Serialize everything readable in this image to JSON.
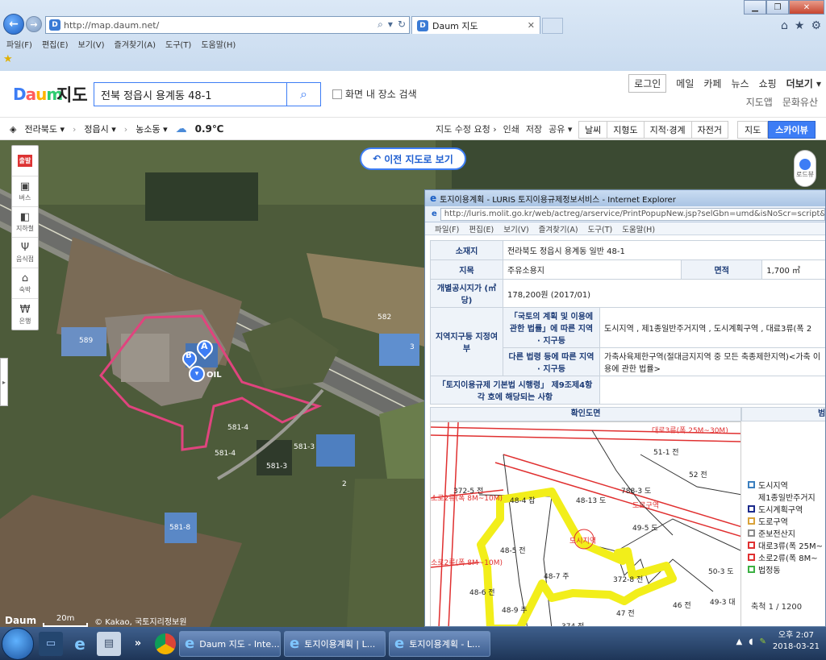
{
  "browser": {
    "url": "http://map.daum.net/",
    "tab_title": "Daum 지도",
    "menu": [
      "파일(F)",
      "편집(E)",
      "보기(V)",
      "즐겨찾기(A)",
      "도구(T)",
      "도움말(H)"
    ]
  },
  "header": {
    "logo": [
      "D",
      "a",
      "u",
      "m"
    ],
    "title": "지도",
    "search_value": "전북 정읍시 용계동 48-1",
    "area_search_label": "화면 내 장소 검색",
    "top_links": [
      "로그인",
      "메일",
      "카페",
      "뉴스",
      "쇼핑",
      "더보기"
    ],
    "sub_links": [
      "지도앱",
      "문화유산"
    ]
  },
  "toolbar": {
    "breadcrumb": [
      "전라북도",
      "정읍시",
      "농소동"
    ],
    "weather": "0.9℃",
    "actions": [
      "지도 수정 요청",
      "인쇄",
      "저장",
      "공유"
    ],
    "map_types": [
      "날씨",
      "지형도",
      "지적·경계",
      "자전거"
    ],
    "views": [
      "지도",
      "스카이뷰"
    ]
  },
  "map": {
    "prev_map_label": "이전 지도로 보기",
    "side_tools": [
      "출발",
      "버스",
      "지하철",
      "음식점",
      "숙박",
      "은행"
    ],
    "roadview_label": "로드뷰",
    "labels": [
      "589",
      "582",
      "581-4",
      "581-3",
      "581-3",
      "581-4",
      "581-8",
      "3",
      "2",
      "OIL"
    ],
    "markers": [
      "A",
      "B"
    ],
    "scale": "20m",
    "copyright": "© Kakao, 국토지리정보원",
    "footer_logo": "Daum"
  },
  "popup": {
    "title": "토지이용계획 - LURIS 토지이용규제정보서비스 - Internet Explorer",
    "url": "http://luris.molit.go.kr/web/actreg/arservice/PrintPopupNew.jsp?selGbn=umd&isNoScr=script&s_type=1&pnu",
    "menu": [
      "파일(F)",
      "편집(E)",
      "보기(V)",
      "즐겨찾기(A)",
      "도구(T)",
      "도움말(H)"
    ],
    "location_label": "소재지",
    "location_value": "전라북도 정읍시 용계동 일반 48-1",
    "category_label": "지목",
    "category_value": "주유소용지",
    "area_label": "면적",
    "area_value": "1,700 ㎡",
    "price_label": "개별공시지가 (㎡당)",
    "price_value": "178,200원 (2017/01)",
    "zone_label": "지역지구등 지정여부",
    "zone_law1": "「국토의 계획 및 이용에 관한 법률」에 따른 지역 · 지구등",
    "zone_law1_value": "도시지역 , 제1종일반주거지역 , 도시계획구역 , 대료3류(폭 2",
    "zone_law2": "다른 법령 등에 따른 지역 · 지구등",
    "zone_law2_value": "가축사육제한구역(절대금지지역 중 모든 축종제한지역)<가축 이용에 관한 법률>",
    "zone_law3": "「토지이용규제 기본법 시행령」 제9조제4항 각 호에 해당되는 사항",
    "confirm_map": "확인도면",
    "legend_title": "범",
    "legend": [
      {
        "label": "도시지역",
        "color": "#3a7fbf"
      },
      {
        "label": "제1종일반주거지",
        "color": "#ffffff"
      },
      {
        "label": "도시계획구역",
        "color": "#1b2a8c"
      },
      {
        "label": "도로구역",
        "color": "#d9a23a"
      },
      {
        "label": "준보전산지",
        "color": "#8c8c8c"
      },
      {
        "label": "대로3류(폭 25M~",
        "color": "#e03030"
      },
      {
        "label": "소로2류(폭 8M~",
        "color": "#e03030"
      },
      {
        "label": "법정동",
        "color": "#3cb043"
      }
    ],
    "scale": "축척 1 / 1200",
    "parcels": [
      "51-1 전",
      "52 전",
      "788-3 도",
      "48-13 도",
      "49-5 도",
      "48-4 잡",
      "48-5 전",
      "48-6 전",
      "48-7 주",
      "48-9 주",
      "372-8 전",
      "46 전",
      "49-3 대",
      "372-5 전",
      "374 전",
      "47 전",
      "50-3 도"
    ],
    "road_labels": [
      "대로3류(폭 25M~30M)",
      "소로2류(폭 8M~10M)",
      "소로2류(폭 8M~10M)",
      "도로구역",
      "도시지역"
    ]
  },
  "taskbar": {
    "apps": [
      "Daum 지도 - Inte...",
      "토지이용계획 | L...",
      "토지이용계획 - L..."
    ],
    "time": "오후 2:07",
    "date": "2018-03-21"
  }
}
